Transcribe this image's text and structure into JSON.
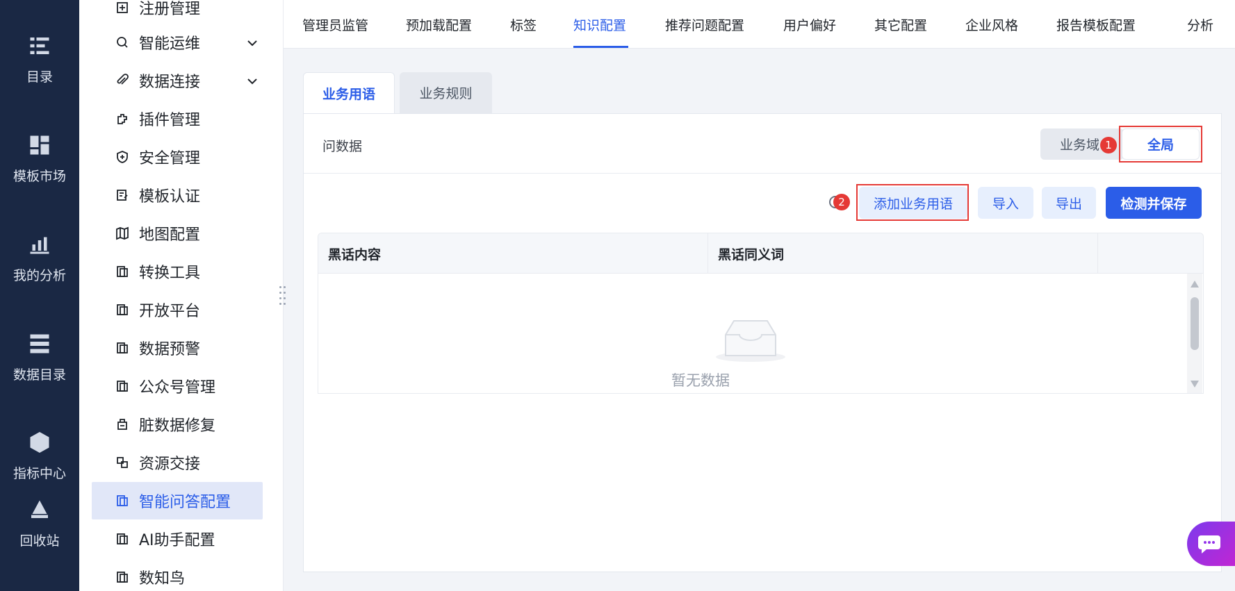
{
  "rail": {
    "items": [
      {
        "label": "目录",
        "icon": "catalog-icon"
      },
      {
        "label": "模板市场",
        "icon": "template-market-icon"
      },
      {
        "label": "我的分析",
        "icon": "analysis-chart-icon"
      },
      {
        "label": "数据目录",
        "icon": "data-catalog-icon"
      },
      {
        "label": "指标中心",
        "icon": "metrics-hexagon-icon"
      },
      {
        "label": "回收站",
        "icon": "recycle-bin-icon"
      }
    ]
  },
  "sidebar": {
    "items": [
      {
        "label": "注册管理"
      },
      {
        "label": "智能运维"
      },
      {
        "label": "数据连接"
      },
      {
        "label": "插件管理"
      },
      {
        "label": "安全管理"
      },
      {
        "label": "模板认证"
      },
      {
        "label": "地图配置"
      },
      {
        "label": "转换工具"
      },
      {
        "label": "开放平台"
      },
      {
        "label": "数据预警"
      },
      {
        "label": "公众号管理"
      },
      {
        "label": "脏数据修复"
      },
      {
        "label": "资源交接"
      },
      {
        "label": "智能问答配置"
      },
      {
        "label": "AI助手配置"
      },
      {
        "label": "数知鸟"
      }
    ]
  },
  "top_tabs": [
    "管理员监管",
    "预加载配置",
    "标签",
    "知识配置",
    "推荐问题配置",
    "用户偏好",
    "其它配置",
    "企业风格",
    "报告模板配置",
    "分析"
  ],
  "sub_tabs": [
    "业务用语",
    "业务规则"
  ],
  "card": {
    "title": "问数据",
    "scope_business": "业务域",
    "scope_global": "全局",
    "badge1": "1",
    "badge2": "2"
  },
  "toolbar": {
    "add_term": "添加业务用语",
    "import": "导入",
    "export": "导出",
    "check_save": "检测并保存"
  },
  "table": {
    "columns": [
      "黑话内容",
      "黑话同义词"
    ],
    "empty_text": "暂无数据"
  },
  "colors": {
    "accent": "#2b5de8",
    "rail_bg": "#1a2844",
    "highlight_red": "#e53935"
  }
}
